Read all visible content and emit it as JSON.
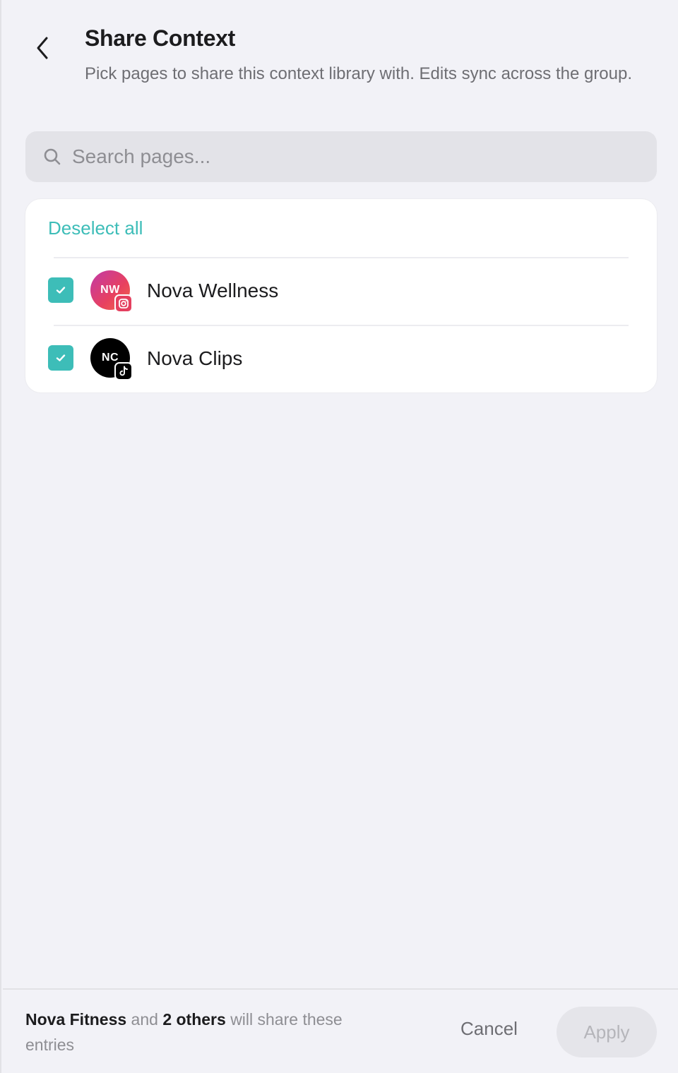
{
  "header": {
    "title": "Share Context",
    "subtitle": "Pick pages to share this context library with. Edits sync across the group."
  },
  "search": {
    "placeholder": "Search pages...",
    "value": ""
  },
  "list": {
    "deselect_label": "Deselect all",
    "items": [
      {
        "initials": "NW",
        "name": "Nova Wellness",
        "platform": "instagram-icon",
        "checked": true
      },
      {
        "initials": "NC",
        "name": "Nova Clips",
        "platform": "tiktok-icon",
        "checked": true
      }
    ]
  },
  "footer": {
    "primary_page": "Nova Fitness",
    "connector": "and",
    "others": "2 others",
    "suffix": "will share these entries",
    "cancel_label": "Cancel",
    "apply_label": "Apply"
  },
  "colors": {
    "accent": "#3dbdb8",
    "background": "#f2f2f7",
    "instagram": "#e4405f",
    "tiktok": "#000000"
  }
}
